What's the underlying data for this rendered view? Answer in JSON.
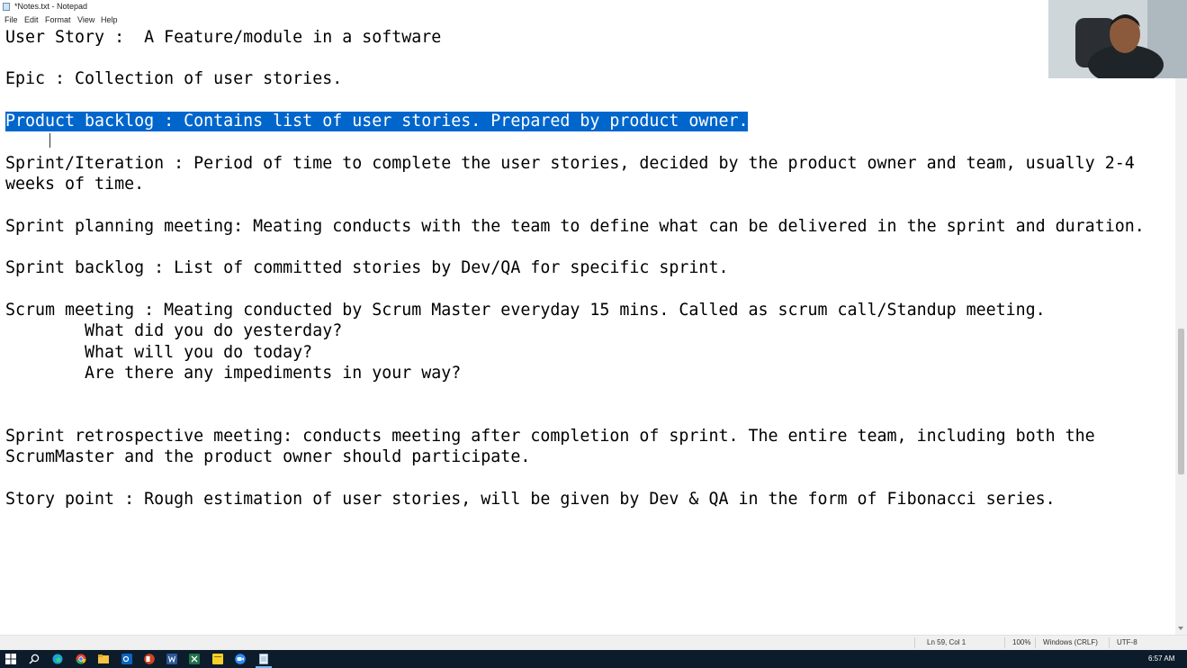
{
  "window": {
    "title": "*Notes.txt - Notepad",
    "icon": "notepad-icon"
  },
  "menu": [
    "File",
    "Edit",
    "Format",
    "View",
    "Help"
  ],
  "editor": {
    "lines": [
      {
        "text": "User Story :  A Feature/module in a software"
      },
      {
        "text": "Epic : Collection of user stories."
      },
      {
        "text": "Product backlog : Contains list of user stories. Prepared by product owner.",
        "selected": true
      },
      {
        "text": "Sprint/Iteration : Period of time to complete the user stories, decided by the product owner and team, usually 2-4"
      },
      {
        "text": "weeks of time."
      },
      {
        "text": "Sprint planning meeting: Meating conducts with the team to define what can be delivered in the sprint and duration."
      },
      {
        "text": "Sprint backlog : List of committed stories by Dev/QA for specific sprint."
      },
      {
        "text": "Scrum meeting : Meating conducted by Scrum Master everyday 15 mins. Called as scrum call/Standup meeting."
      },
      {
        "text": "        What did you do yesterday?"
      },
      {
        "text": "        What will you do today?"
      },
      {
        "text": "        Are there any impediments in your way?"
      },
      {
        "text": "Sprint retrospective meeting: conducts meeting after completion of sprint. The entire team, including both the"
      },
      {
        "text": "ScrumMaster and the product owner should participate."
      },
      {
        "text": "Story point : Rough estimation of user stories, will be given by Dev & QA in the form of Fibonacci series."
      }
    ]
  },
  "status": {
    "position": "Ln 59, Col 1",
    "zoom": "100%",
    "line_ending": "Windows (CRLF)",
    "encoding": "UTF-8"
  },
  "taskbar": {
    "icons": [
      "windows-start-icon",
      "search-icon",
      "edge-icon",
      "chrome-icon",
      "file-explorer-icon",
      "outlook-icon",
      "powerpoint-icon",
      "word-icon",
      "excel-icon",
      "sticky-notes-icon",
      "zoom-icon",
      "notepad-icon"
    ],
    "active": "notepad-icon",
    "clock": "6:57 AM"
  },
  "colors": {
    "selection": "#0066cc",
    "taskbar": "#0d1c2b",
    "status_bar": "#f0f0f0"
  }
}
